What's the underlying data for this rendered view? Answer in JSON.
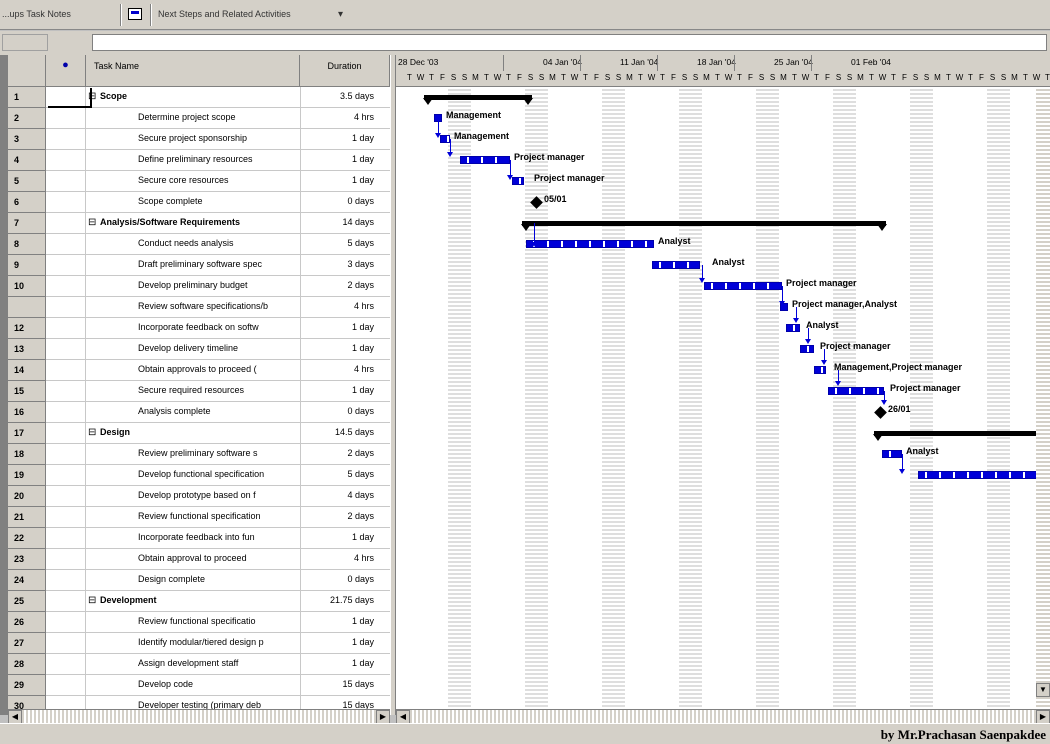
{
  "toolbar": {
    "left_text": "...ups  Task  Notes",
    "view_name": "Next Steps and Related Activities",
    "dropdown": "▾"
  },
  "entry": {
    "value": ""
  },
  "table": {
    "indicator_header": "●",
    "name_header": "Task Name",
    "duration_header": "Duration",
    "rows": [
      {
        "id": "1",
        "name": "Scope",
        "duration": "3.5 days",
        "summary": true,
        "indent": 0
      },
      {
        "id": "2",
        "name": "Determine project scope",
        "duration": "4 hrs",
        "summary": false,
        "indent": 1
      },
      {
        "id": "3",
        "name": "Secure project sponsorship",
        "duration": "1 day",
        "summary": false,
        "indent": 1
      },
      {
        "id": "4",
        "name": "Define preliminary resources",
        "duration": "1 day",
        "summary": false,
        "indent": 1
      },
      {
        "id": "5",
        "name": "Secure core resources",
        "duration": "1 day",
        "summary": false,
        "indent": 1
      },
      {
        "id": "6",
        "name": "Scope complete",
        "duration": "0 days",
        "summary": false,
        "indent": 1
      },
      {
        "id": "7",
        "name": "Analysis/Software Requirements",
        "duration": "14 days",
        "summary": true,
        "indent": 0
      },
      {
        "id": "8",
        "name": "Conduct needs analysis",
        "duration": "5 days",
        "summary": false,
        "indent": 1
      },
      {
        "id": "9",
        "name": "Draft preliminary software spec",
        "duration": "3 days",
        "summary": false,
        "indent": 1
      },
      {
        "id": "10",
        "name": "Develop preliminary budget",
        "duration": "2 days",
        "summary": false,
        "indent": 1
      },
      {
        "id": "",
        "name": "Review software specifications/b",
        "duration": "4 hrs",
        "summary": false,
        "indent": 1
      },
      {
        "id": "12",
        "name": "Incorporate feedback on softw",
        "duration": "1 day",
        "summary": false,
        "indent": 1
      },
      {
        "id": "13",
        "name": "Develop delivery timeline",
        "duration": "1 day",
        "summary": false,
        "indent": 1
      },
      {
        "id": "14",
        "name": "Obtain approvals to proceed (",
        "duration": "4 hrs",
        "summary": false,
        "indent": 1
      },
      {
        "id": "15",
        "name": "Secure required resources",
        "duration": "1 day",
        "summary": false,
        "indent": 1
      },
      {
        "id": "16",
        "name": "Analysis complete",
        "duration": "0 days",
        "summary": false,
        "indent": 1
      },
      {
        "id": "17",
        "name": "Design",
        "duration": "14.5 days",
        "summary": true,
        "indent": 0
      },
      {
        "id": "18",
        "name": "Review preliminary software s",
        "duration": "2 days",
        "summary": false,
        "indent": 1
      },
      {
        "id": "19",
        "name": "Develop functional specification",
        "duration": "5 days",
        "summary": false,
        "indent": 1
      },
      {
        "id": "20",
        "name": "Develop prototype based on f",
        "duration": "4 days",
        "summary": false,
        "indent": 1
      },
      {
        "id": "21",
        "name": "Review functional specification",
        "duration": "2 days",
        "summary": false,
        "indent": 1
      },
      {
        "id": "22",
        "name": "Incorporate feedback into fun",
        "duration": "1 day",
        "summary": false,
        "indent": 1
      },
      {
        "id": "23",
        "name": "Obtain approval to proceed",
        "duration": "4 hrs",
        "summary": false,
        "indent": 1
      },
      {
        "id": "24",
        "name": "Design complete",
        "duration": "0 days",
        "summary": false,
        "indent": 1
      },
      {
        "id": "25",
        "name": "Development",
        "duration": "21.75 days",
        "summary": true,
        "indent": 0
      },
      {
        "id": "26",
        "name": "Review functional specificatio",
        "duration": "1 day",
        "summary": false,
        "indent": 1
      },
      {
        "id": "27",
        "name": "Identify modular/tiered design p",
        "duration": "1 day",
        "summary": false,
        "indent": 1
      },
      {
        "id": "28",
        "name": "Assign development staff",
        "duration": "1 day",
        "summary": false,
        "indent": 1
      },
      {
        "id": "29",
        "name": "Develop code",
        "duration": "15 days",
        "summary": false,
        "indent": 1
      },
      {
        "id": "30",
        "name": "Developer testing (primary deb",
        "duration": "15 days",
        "summary": false,
        "indent": 1
      }
    ]
  },
  "timescale": {
    "weeks": [
      "28 Dec '03",
      "04 Jan '04",
      "11 Jan '04",
      "18 Jan '04",
      "25 Jan '04",
      "01 Feb '04"
    ],
    "days": [
      "T",
      "W",
      "T",
      "F",
      "S",
      "S",
      "M",
      "T",
      "W",
      "T",
      "F",
      "S",
      "S",
      "M",
      "T",
      "W",
      "T",
      "F",
      "S",
      "S",
      "M",
      "T",
      "W",
      "T",
      "F",
      "S",
      "S",
      "M",
      "T",
      "W",
      "T",
      "F",
      "S",
      "S",
      "M",
      "T",
      "W",
      "T",
      "F",
      "S",
      "S",
      "M",
      "T",
      "W",
      "T",
      "F",
      "S",
      "S",
      "M",
      "T",
      "W",
      "T",
      "F",
      "S",
      "S",
      "M",
      "T",
      "W",
      "T"
    ]
  },
  "gantt_labels": {
    "r2": "Management",
    "r3": "Management",
    "r4": "Project manager",
    "r5": "Project manager",
    "r6": "05/01",
    "r8": "Analyst",
    "r9": "Analyst",
    "r10": "Project manager",
    "r11": "Project manager,Analyst",
    "r12": "Analyst",
    "r13": "Project manager",
    "r14": "Management,Project manager",
    "r15": "Project manager",
    "r16": "26/01",
    "r18": "Analyst"
  },
  "credit": "by Mr.Prachasan  Saenpakdee",
  "colors": {
    "bar": "#0000d8",
    "summary": "#000000",
    "chrome": "#d4d0c8"
  }
}
